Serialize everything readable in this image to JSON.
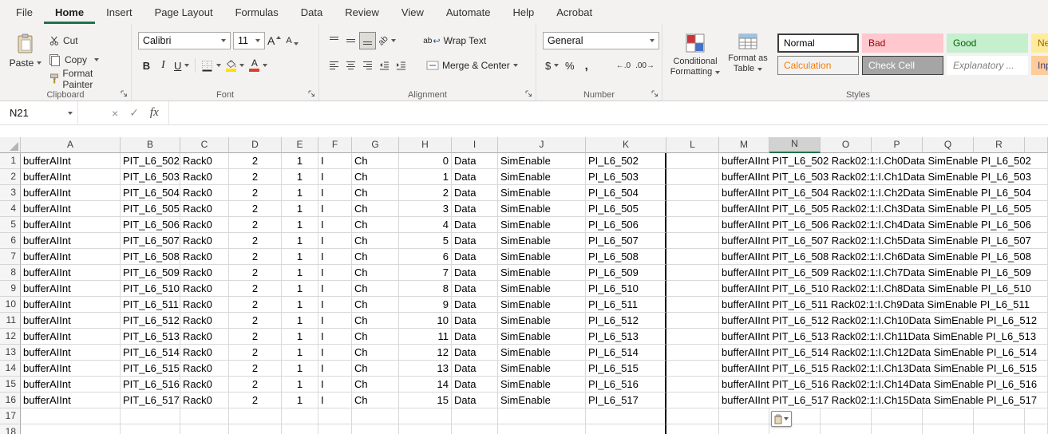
{
  "tabs": {
    "items": [
      "File",
      "Home",
      "Insert",
      "Page Layout",
      "Formulas",
      "Data",
      "Review",
      "View",
      "Automate",
      "Help",
      "Acrobat"
    ],
    "active": "Home"
  },
  "ribbon": {
    "clipboard": {
      "label": "Clipboard",
      "paste": "Paste",
      "cut": "Cut",
      "copy": "Copy",
      "format_painter": "Format Painter"
    },
    "font": {
      "label": "Font",
      "name_value": "Calibri",
      "size_value": "11",
      "bold": "B",
      "italic": "I",
      "underline": "U",
      "grow_letter": "A",
      "shrink_letter": "A",
      "color_letter": "A"
    },
    "alignment": {
      "label": "Alignment",
      "wrap_text": "Wrap Text",
      "merge_center": "Merge & Center",
      "wrap_icon_text": "ab",
      "return_arrow": "↩",
      "orientation_icon_text": "ab"
    },
    "number": {
      "label": "Number",
      "format_value": "General",
      "currency": "$",
      "percent": "%",
      "comma": ",",
      "increase_decimal": "←.0",
      "decrease_decimal": ".00→"
    },
    "styles": {
      "label": "Styles",
      "conditional_formatting": "Conditional Formatting",
      "format_as_table": "Format as Table",
      "gallery": [
        {
          "name": "Normal",
          "bg": "#ffffff",
          "color": "#000000",
          "selected": true
        },
        {
          "name": "Bad",
          "bg": "#ffc7ce",
          "color": "#9c0006"
        },
        {
          "name": "Good",
          "bg": "#c6efce",
          "color": "#006100"
        },
        {
          "name": "Neutral",
          "bg": "#ffeb9c",
          "color": "#9c6500"
        },
        {
          "name": "Calculation",
          "bg": "#f2f2f2",
          "color": "#fa7d00",
          "border": "#7f7f7f"
        },
        {
          "name": "Check Cell",
          "bg": "#a5a5a5",
          "color": "#ffffff",
          "border": "#3f3f3f"
        },
        {
          "name": "Explanatory ...",
          "bg": "#ffffff",
          "color": "#7f7f7f",
          "italic": true
        },
        {
          "name": "Input",
          "bg": "#ffcc99",
          "color": "#3f3f76"
        }
      ]
    }
  },
  "formula_bar": {
    "name_box": "N21",
    "formula": "",
    "fx": "fx",
    "cancel": "×",
    "enter": "✓"
  },
  "grid": {
    "selected_column": "N",
    "columns": [
      "A",
      "B",
      "C",
      "D",
      "E",
      "F",
      "G",
      "H",
      "I",
      "J",
      "K",
      "L",
      "M",
      "N",
      "O",
      "P",
      "Q",
      "R"
    ],
    "rows": [
      {
        "n": "1",
        "cells": [
          "bufferAIInt",
          "PIT_L6_502",
          "Rack0",
          "2",
          "1",
          "I",
          "Ch",
          "0",
          "Data",
          "SimEnable",
          "PI_L6_502",
          "",
          "bufferAIInt PIT_L6_502 Rack02:1:I.Ch0Data SimEnable PI_L6_502"
        ]
      },
      {
        "n": "2",
        "cells": [
          "bufferAIInt",
          "PIT_L6_503",
          "Rack0",
          "2",
          "1",
          "I",
          "Ch",
          "1",
          "Data",
          "SimEnable",
          "PI_L6_503",
          "",
          "bufferAIInt PIT_L6_503 Rack02:1:I.Ch1Data SimEnable PI_L6_503"
        ]
      },
      {
        "n": "3",
        "cells": [
          "bufferAIInt",
          "PIT_L6_504",
          "Rack0",
          "2",
          "1",
          "I",
          "Ch",
          "2",
          "Data",
          "SimEnable",
          "PI_L6_504",
          "",
          "bufferAIInt PIT_L6_504 Rack02:1:I.Ch2Data SimEnable PI_L6_504"
        ]
      },
      {
        "n": "4",
        "cells": [
          "bufferAIInt",
          "PIT_L6_505",
          "Rack0",
          "2",
          "1",
          "I",
          "Ch",
          "3",
          "Data",
          "SimEnable",
          "PI_L6_505",
          "",
          "bufferAIInt PIT_L6_505 Rack02:1:I.Ch3Data SimEnable PI_L6_505"
        ]
      },
      {
        "n": "5",
        "cells": [
          "bufferAIInt",
          "PIT_L6_506",
          "Rack0",
          "2",
          "1",
          "I",
          "Ch",
          "4",
          "Data",
          "SimEnable",
          "PI_L6_506",
          "",
          "bufferAIInt PIT_L6_506 Rack02:1:I.Ch4Data SimEnable PI_L6_506"
        ]
      },
      {
        "n": "6",
        "cells": [
          "bufferAIInt",
          "PIT_L6_507",
          "Rack0",
          "2",
          "1",
          "I",
          "Ch",
          "5",
          "Data",
          "SimEnable",
          "PI_L6_507",
          "",
          "bufferAIInt PIT_L6_507 Rack02:1:I.Ch5Data SimEnable PI_L6_507"
        ]
      },
      {
        "n": "7",
        "cells": [
          "bufferAIInt",
          "PIT_L6_508",
          "Rack0",
          "2",
          "1",
          "I",
          "Ch",
          "6",
          "Data",
          "SimEnable",
          "PI_L6_508",
          "",
          "bufferAIInt PIT_L6_508 Rack02:1:I.Ch6Data SimEnable PI_L6_508"
        ]
      },
      {
        "n": "8",
        "cells": [
          "bufferAIInt",
          "PIT_L6_509",
          "Rack0",
          "2",
          "1",
          "I",
          "Ch",
          "7",
          "Data",
          "SimEnable",
          "PI_L6_509",
          "",
          "bufferAIInt PIT_L6_509 Rack02:1:I.Ch7Data SimEnable PI_L6_509"
        ]
      },
      {
        "n": "9",
        "cells": [
          "bufferAIInt",
          "PIT_L6_510",
          "Rack0",
          "2",
          "1",
          "I",
          "Ch",
          "8",
          "Data",
          "SimEnable",
          "PI_L6_510",
          "",
          "bufferAIInt PIT_L6_510 Rack02:1:I.Ch8Data SimEnable PI_L6_510"
        ]
      },
      {
        "n": "10",
        "cells": [
          "bufferAIInt",
          "PIT_L6_511",
          "Rack0",
          "2",
          "1",
          "I",
          "Ch",
          "9",
          "Data",
          "SimEnable",
          "PI_L6_511",
          "",
          "bufferAIInt PIT_L6_511 Rack02:1:I.Ch9Data SimEnable PI_L6_511"
        ]
      },
      {
        "n": "11",
        "cells": [
          "bufferAIInt",
          "PIT_L6_512",
          "Rack0",
          "2",
          "1",
          "I",
          "Ch",
          "10",
          "Data",
          "SimEnable",
          "PI_L6_512",
          "",
          "bufferAIInt PIT_L6_512 Rack02:1:I.Ch10Data SimEnable PI_L6_512"
        ]
      },
      {
        "n": "12",
        "cells": [
          "bufferAIInt",
          "PIT_L6_513",
          "Rack0",
          "2",
          "1",
          "I",
          "Ch",
          "11",
          "Data",
          "SimEnable",
          "PI_L6_513",
          "",
          "bufferAIInt PIT_L6_513 Rack02:1:I.Ch11Data SimEnable PI_L6_513"
        ]
      },
      {
        "n": "13",
        "cells": [
          "bufferAIInt",
          "PIT_L6_514",
          "Rack0",
          "2",
          "1",
          "I",
          "Ch",
          "12",
          "Data",
          "SimEnable",
          "PI_L6_514",
          "",
          "bufferAIInt PIT_L6_514 Rack02:1:I.Ch12Data SimEnable PI_L6_514"
        ]
      },
      {
        "n": "14",
        "cells": [
          "bufferAIInt",
          "PIT_L6_515",
          "Rack0",
          "2",
          "1",
          "I",
          "Ch",
          "13",
          "Data",
          "SimEnable",
          "PI_L6_515",
          "",
          "bufferAIInt PIT_L6_515 Rack02:1:I.Ch13Data SimEnable PI_L6_515"
        ]
      },
      {
        "n": "15",
        "cells": [
          "bufferAIInt",
          "PIT_L6_516",
          "Rack0",
          "2",
          "1",
          "I",
          "Ch",
          "14",
          "Data",
          "SimEnable",
          "PI_L6_516",
          "",
          "bufferAIInt PIT_L6_516 Rack02:1:I.Ch14Data SimEnable PI_L6_516"
        ]
      },
      {
        "n": "16",
        "cells": [
          "bufferAIInt",
          "PIT_L6_517",
          "Rack0",
          "2",
          "1",
          "I",
          "Ch",
          "15",
          "Data",
          "SimEnable",
          "PI_L6_517",
          "",
          "bufferAIInt PIT_L6_517 Rack02:1:I.Ch15Data SimEnable PI_L6_517"
        ]
      },
      {
        "n": "17",
        "cells": []
      },
      {
        "n": "18",
        "cells": []
      }
    ]
  },
  "colors": {
    "accent": "#217346",
    "fill_swatch": "#ffe100",
    "font_color_swatch": "#e03e2d",
    "selected_header_border": "#1f7246",
    "gridline": "#d9d9d9"
  }
}
